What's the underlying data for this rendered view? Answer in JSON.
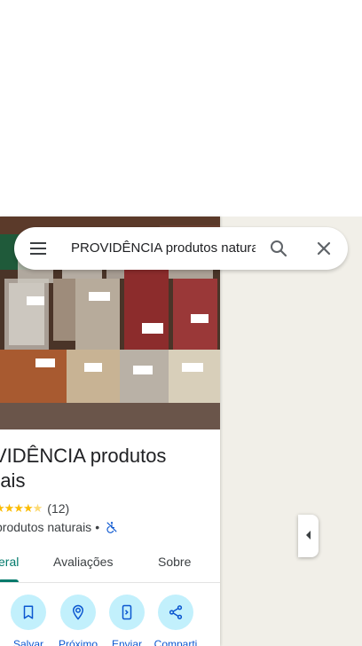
{
  "search": {
    "query": "PROVIDÊNCIA produtos naturais",
    "menu_icon": "menu-icon",
    "search_icon": "search-icon",
    "close_icon": "close-icon"
  },
  "place": {
    "title": "VIDÊNCIA produtos\nrais",
    "rating_count": "(12)",
    "rating": 4.5,
    "category": "produtos naturais",
    "separator": "•",
    "accessibility_icon": "not-accessible-icon"
  },
  "tabs": [
    {
      "label": "eral",
      "active": true
    },
    {
      "label": "Avaliações",
      "active": false
    },
    {
      "label": "Sobre",
      "active": false
    }
  ],
  "actions": [
    {
      "label": "Salvar",
      "icon": "bookmark-icon"
    },
    {
      "label": "Próximo",
      "icon": "nearby-icon"
    },
    {
      "label": "Enviar",
      "icon": "send-to-phone-icon"
    },
    {
      "label": "Comparti",
      "icon": "share-icon"
    }
  ],
  "colors": {
    "accent": "#00796b",
    "action_bg": "#c2f0fc",
    "action_text": "#0b57d0",
    "star": "#fbbc04",
    "map_bg": "#f1efe8"
  },
  "collapse_icon": "caret-left-icon"
}
